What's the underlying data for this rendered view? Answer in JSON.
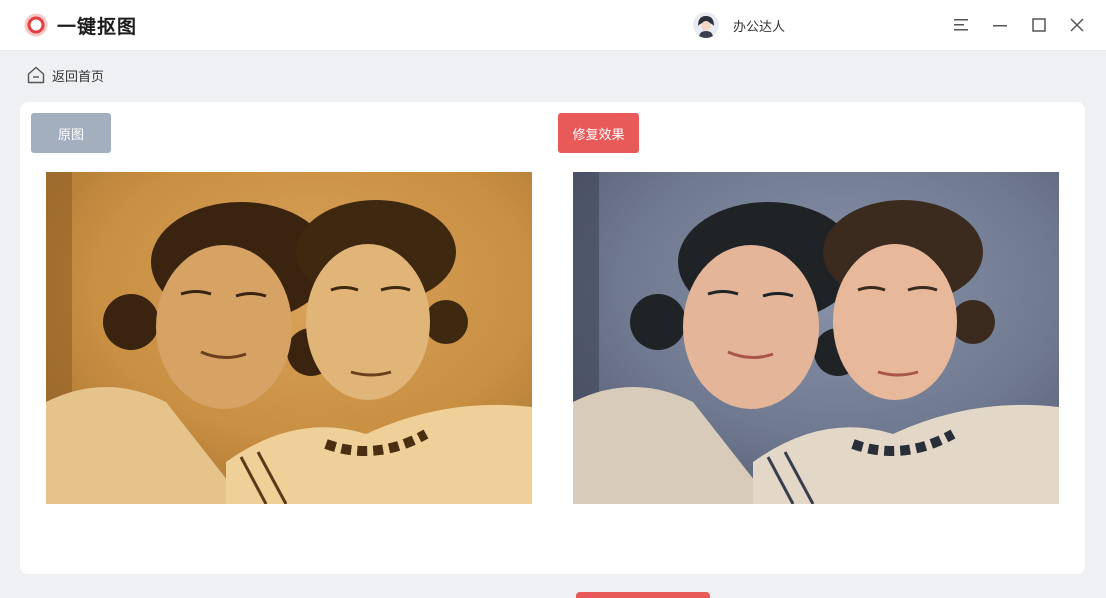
{
  "app": {
    "title": "一键抠图",
    "user_name": "办公达人"
  },
  "icons": {
    "logo": "red-ring-logo",
    "menu": "hamburger-menu-icon",
    "minimize": "minimize-icon",
    "maximize": "maximize-icon",
    "close": "close-icon",
    "home": "home-icon"
  },
  "nav": {
    "back_label": "返回首页"
  },
  "compare": {
    "original_label": "原图",
    "result_label": "修复效果"
  },
  "colors": {
    "accent": "#e85a5a",
    "original_tag": "#a3aebf",
    "background": "#eef0f4"
  }
}
